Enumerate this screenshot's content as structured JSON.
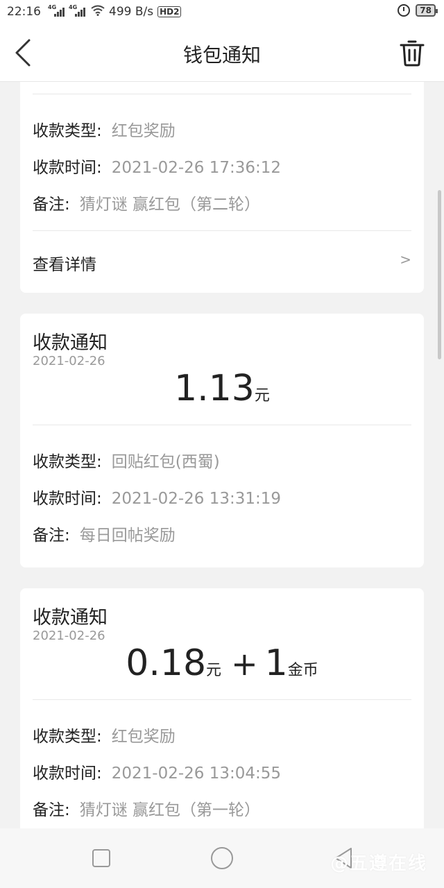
{
  "status_bar": {
    "time": "22:16",
    "network_speed": "499 B/s",
    "battery": "78",
    "sim1_label": "4G",
    "sim2_label": "4G",
    "hd_label": "HD2"
  },
  "header": {
    "title": "钱包通知"
  },
  "icons": {
    "back": "chevron-left-icon",
    "trash": "trash-icon",
    "detail_chevron": "chevron-right-icon"
  },
  "cards": [
    {
      "type_label": "收款类型:",
      "type_value": "红包奖励",
      "time_label": "收款时间:",
      "time_value": "2021-02-26 17:36:12",
      "note_label": "备注:",
      "note_value": "猜灯谜 赢红包（第二轮）",
      "detail_label": "查看详情",
      "detail_chevron": ">"
    },
    {
      "title": "收款通知",
      "date": "2021-02-26",
      "amount": "1.13",
      "amount_unit": "元",
      "type_label": "收款类型:",
      "type_value": "回贴红包(西蜀)",
      "time_label": "收款时间:",
      "time_value": "2021-02-26 13:31:19",
      "note_label": "备注:",
      "note_value": "每日回帖奖励"
    },
    {
      "title": "收款通知",
      "date": "2021-02-26",
      "amount": "0.18",
      "amount_unit": "元",
      "plus": "+",
      "coins": "1",
      "coins_unit": "金币",
      "type_label": "收款类型:",
      "type_value": "红包奖励",
      "time_label": "收款时间:",
      "time_value": "2021-02-26 13:04:55",
      "note_label": "备注:",
      "note_value": "猜灯谜 赢红包（第一轮）"
    }
  ],
  "watermark": "@五遵在线",
  "colors": {
    "background": "#f2f2f2",
    "card": "#ffffff",
    "primary_text": "#222222",
    "secondary_text": "#999999"
  }
}
